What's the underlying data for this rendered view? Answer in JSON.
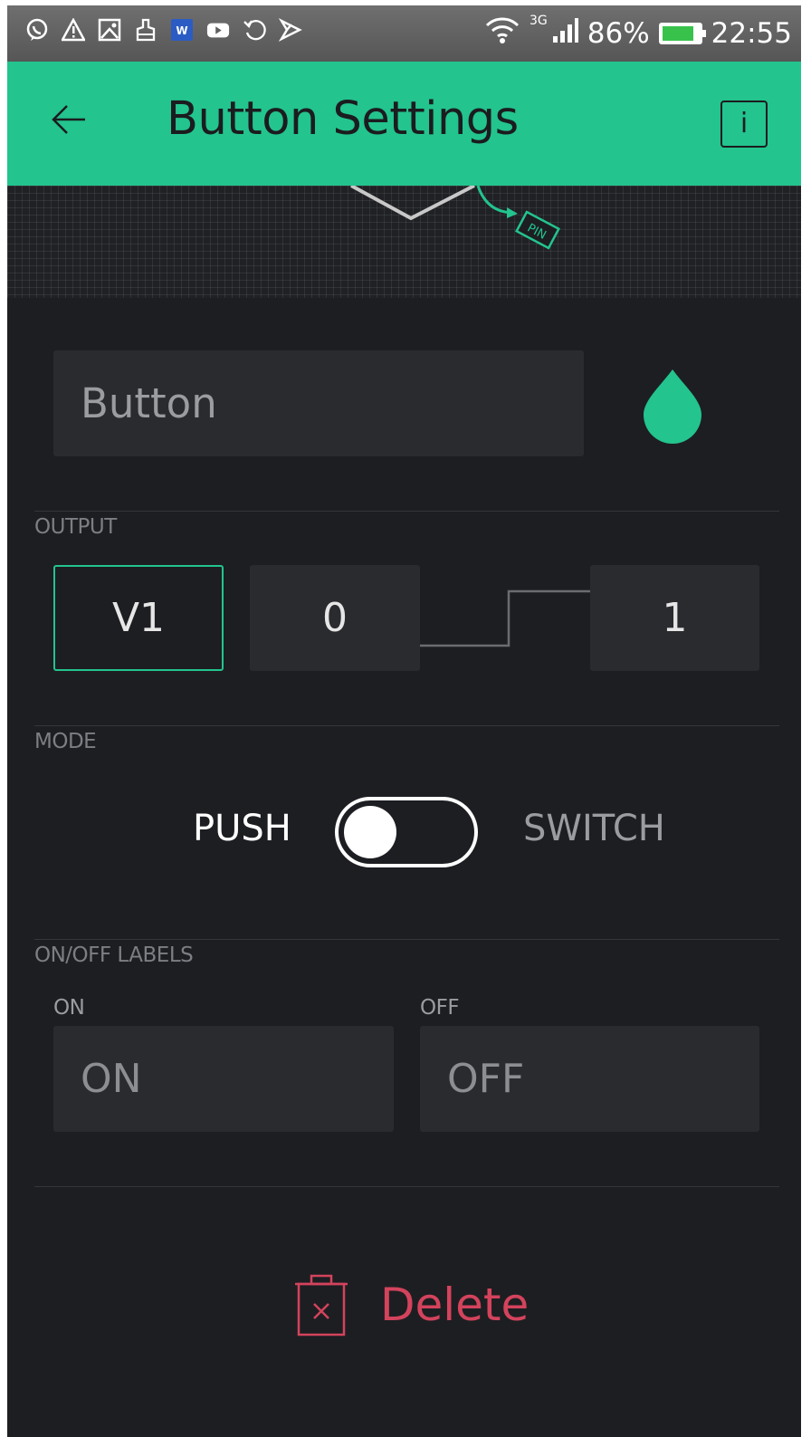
{
  "status_bar": {
    "network": "3G",
    "battery": "86%",
    "battery_level": 0.86,
    "time": "22:55",
    "notification_icons": [
      "viber-icon",
      "warning-icon",
      "gallery-icon",
      "cleaner-icon",
      "word-icon",
      "youtube-icon",
      "sync-icon",
      "shield-icon"
    ]
  },
  "app_bar": {
    "title": "Button Settings",
    "info_label": "i"
  },
  "preview": {
    "pin_tag": "PIN"
  },
  "widget": {
    "name_value": "Button",
    "color": "#23C48E"
  },
  "output": {
    "section_label": "OUTPUT",
    "pin": "V1",
    "low_value": "0",
    "high_value": "1"
  },
  "mode": {
    "section_label": "MODE",
    "push_label": "PUSH",
    "switch_label": "SWITCH",
    "selected": "PUSH"
  },
  "labels": {
    "section_label": "ON/OFF LABELS",
    "on_caption": "ON",
    "on_value": "ON",
    "off_caption": "OFF",
    "off_value": "OFF"
  },
  "actions": {
    "delete_label": "Delete"
  },
  "colors": {
    "accent": "#23C48E",
    "background": "#1D1E22",
    "danger": "#D3435C"
  }
}
